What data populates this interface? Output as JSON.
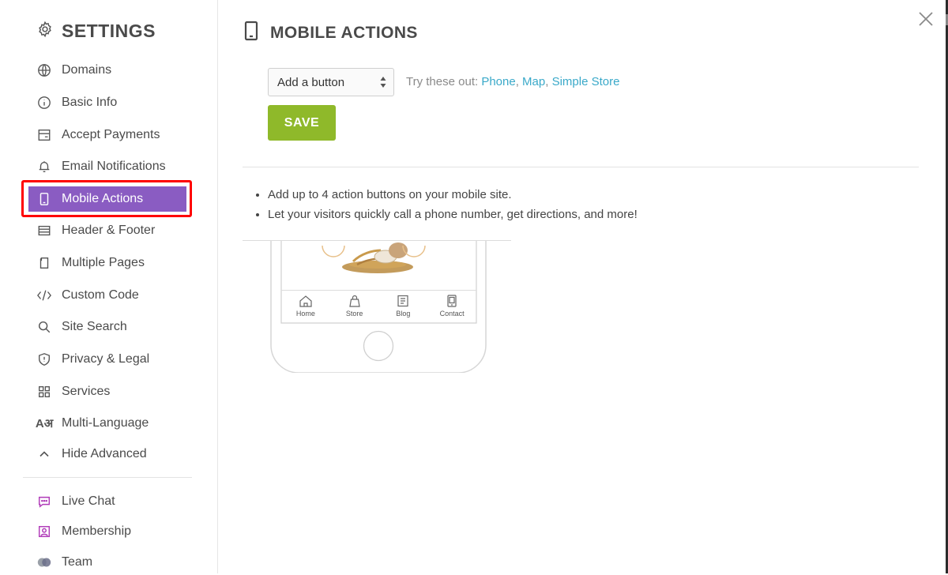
{
  "sidebar": {
    "title": "SETTINGS",
    "title_icon": "gear-icon",
    "items": [
      {
        "label": "Domains",
        "icon": "globe-icon"
      },
      {
        "label": "Basic Info",
        "icon": "info-icon"
      },
      {
        "label": "Accept Payments",
        "icon": "payment-icon"
      },
      {
        "label": "Email Notifications",
        "icon": "bell-icon"
      },
      {
        "label": "Mobile Actions",
        "icon": "mobile-icon",
        "active": true
      },
      {
        "label": "Header & Footer",
        "icon": "header-footer-icon"
      },
      {
        "label": "Multiple Pages",
        "icon": "pages-icon"
      },
      {
        "label": "Custom Code",
        "icon": "code-icon"
      },
      {
        "label": "Site Search",
        "icon": "search-icon"
      },
      {
        "label": "Privacy & Legal",
        "icon": "shield-icon"
      },
      {
        "label": "Services",
        "icon": "grid-icon"
      },
      {
        "label": "Multi-Language",
        "icon": "language-icon"
      },
      {
        "label": "Hide Advanced",
        "icon": "chevron-up-icon"
      }
    ],
    "apps": [
      {
        "label": "Live Chat",
        "icon": "chat-icon"
      },
      {
        "label": "Membership",
        "icon": "membership-icon"
      },
      {
        "label": "Team",
        "icon": "team-icon"
      }
    ]
  },
  "main": {
    "title": "MOBILE ACTIONS",
    "title_icon": "mobile-icon",
    "select": {
      "value": "Add a button"
    },
    "try_prefix": "Try these out:",
    "suggestions": [
      "Phone",
      "Map",
      "Simple Store"
    ],
    "save_label": "SAVE",
    "bullets": [
      "Add up to 4 action buttons on your mobile site.",
      "Let your visitors quickly call a phone number, get directions, and more!"
    ],
    "phone_tabs": [
      {
        "label": "Home",
        "icon": "home-icon"
      },
      {
        "label": "Store",
        "icon": "bag-icon"
      },
      {
        "label": "Blog",
        "icon": "blog-icon"
      },
      {
        "label": "Contact",
        "icon": "contact-icon"
      }
    ]
  },
  "colors": {
    "active_bg": "#8a5cc2",
    "highlight": "#ff0000",
    "save": "#8fb92a",
    "link": "#3aa9c9",
    "app_icon": "#b03bb8"
  }
}
